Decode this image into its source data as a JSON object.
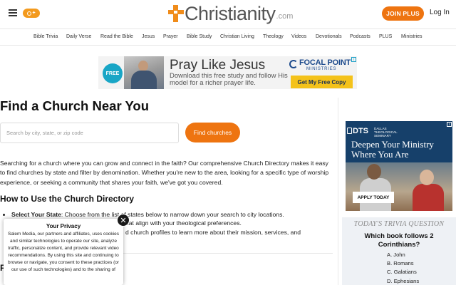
{
  "header": {
    "logo_text": "Christianity",
    "logo_suffix": ".com",
    "join_label": "JOIN PLUS",
    "login_label": "Log In"
  },
  "nav": {
    "items": [
      "Bible Trivia",
      "Daily Verse",
      "Read the Bible",
      "Jesus",
      "Prayer",
      "Bible Study",
      "Christian Living",
      "Theology",
      "Videos",
      "Devotionals",
      "Podcasts",
      "PLUS",
      "Ministries"
    ]
  },
  "ad_banner": {
    "badge": "FREE",
    "title": "Pray Like Jesus",
    "subtitle": "Download this free study and follow His model for a richer prayer life.",
    "brand": "FOCAL POINT",
    "brand_sub": "MINISTRIES",
    "cta": "Get My Free Copy"
  },
  "main": {
    "title": "Find a Church Near You",
    "search_placeholder": "Search by city, state, or zip code",
    "search_button": "Find churches",
    "intro": "Searching for a church where you can grow and connect in the faith? Our comprehensive Church Directory makes it easy to find churches by state and filter by denomination. Whether you're new to the area, looking for a specific type of worship experience, or seeking a community that shares your faith, we've got you covered.",
    "how_title": "How to Use the Church Directory",
    "bullet_1_label": "Select Your State",
    "bullet_1_text": ": Choose from the list of states below to narrow down your search to city locations.",
    "bullet_2_text": "hat align with your theological preferences.",
    "bullet_3_text": "d church profiles to learn more about their mission, services, and",
    "partial_heading": "F"
  },
  "privacy": {
    "title": "Your Privacy",
    "body": "Salem Media, our partners and affiliates, uses cookies and similar technologies to operate our site, analyze traffic, personalize content, and provide relevant video recommendations. By using this site and continuing to browse or navigate, you consent to these practices (or our use of such technologies) and to the sharing of",
    "close": "✕"
  },
  "side_ad": {
    "brand": "DTS",
    "brand_sub": "DALLAS THEOLOGICAL SEMINARY",
    "headline": "Deepen Your Ministry Where You Are",
    "cta": "APPLY TODAY"
  },
  "trivia": {
    "label": "TODAY'S TRIVIA QUESTION",
    "question": "Which book follows 2 Corinthians?",
    "options": [
      "A. John",
      "B. Romans",
      "C. Galatians",
      "D. Ephesians"
    ]
  },
  "colors": {
    "accent": "#ee7410",
    "logo_cross": "#f08c1a",
    "trivia_bg": "#eef1f5",
    "side_ad_bg": "#16406a"
  }
}
